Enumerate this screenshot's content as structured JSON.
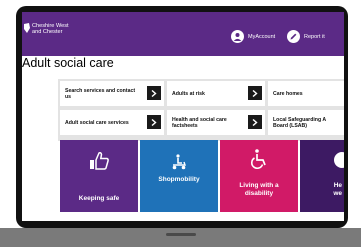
{
  "header": {
    "logo_line1": "Cheshire West",
    "logo_line2": "and Chester",
    "account_label": "MyAccount",
    "report_label": "Report it",
    "background": "#5b2a86"
  },
  "page_title": "Adult social care",
  "links": [
    {
      "label_line1": "Search services and contact",
      "label_line2": "us"
    },
    {
      "label_line1": "Adults at risk",
      "label_line2": ""
    },
    {
      "label_line1": "Care homes",
      "label_line2": ""
    },
    {
      "label_line1": "Adult social care services",
      "label_line2": ""
    },
    {
      "label_line1": "Health and social care",
      "label_line2": "factsheets"
    },
    {
      "label_line1": "Local Safeguarding A",
      "label_line2": "Board (LSAB)"
    }
  ],
  "tiles": [
    {
      "label_line1": "Keeping safe",
      "label_line2": "",
      "color": "#5b2a86",
      "icon": "thumbs-up-icon"
    },
    {
      "label_line1": "Shopmobility",
      "label_line2": "",
      "color": "#1f72b8",
      "icon": "mobility-scooter-icon"
    },
    {
      "label_line1": "Living with a",
      "label_line2": "disability",
      "color": "#d11a67",
      "icon": "wheelchair-icon"
    },
    {
      "label_line1": "He",
      "label_line2": "we",
      "color": "#3d1a63",
      "icon": "partial-icon"
    }
  ]
}
